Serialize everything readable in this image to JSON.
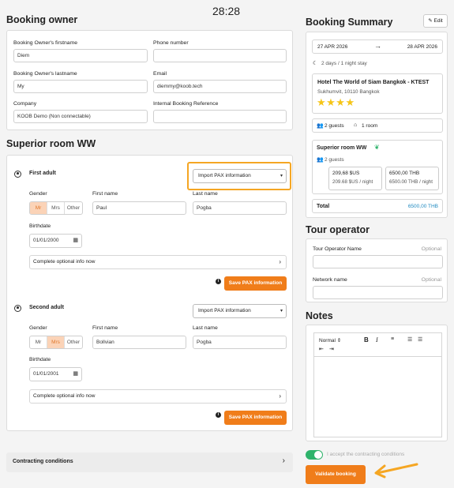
{
  "timer": "28:28",
  "owner": {
    "title": "Booking owner",
    "firstname_label": "Booking Owner's firstname",
    "firstname_value": "Diem",
    "phone_label": "Phone number",
    "phone_value": "",
    "lastname_label": "Booking Owner's lastname",
    "lastname_value": "My",
    "email_label": "Email",
    "email_value": "diemmy@koob.tech",
    "company_label": "Company",
    "company_value": "KOOB Demo (Non connectable)",
    "internal_ref_label": "Internal Booking Reference",
    "internal_ref_value": ""
  },
  "room": {
    "title": "Superior room WW",
    "adults": [
      {
        "title": "First adult",
        "import_label": "Import PAX information",
        "gender_label": "Gender",
        "genders": [
          "Mr",
          "Mrs",
          "Other"
        ],
        "selected_gender": "Mr",
        "firstname_label": "First name",
        "firstname_value": "Paul",
        "lastname_label": "Last name",
        "lastname_value": "Pogba",
        "birthdate_label": "Birthdate",
        "birthdate_value": "01/01/2000",
        "optional_label": "Complete optional info now",
        "save_label": "Save PAX information"
      },
      {
        "title": "Second adult",
        "import_label": "Import PAX information",
        "gender_label": "Gender",
        "genders": [
          "Mr",
          "Mrs",
          "Other"
        ],
        "selected_gender": "Mrs",
        "firstname_label": "First name",
        "firstname_value": "Bollvian",
        "lastname_label": "Last name",
        "lastname_value": "Pogba",
        "birthdate_label": "Birthdate",
        "birthdate_value": "01/01/2001",
        "optional_label": "Complete optional info now",
        "save_label": "Save PAX information"
      }
    ]
  },
  "contracting": {
    "label": "Contracting conditions"
  },
  "summary": {
    "title": "Booking Summary",
    "edit_label": "Edit",
    "date_from": "27 APR 2026",
    "date_to": "28 APR 2026",
    "stay_text": "2 days / 1 night stay",
    "hotel_name": "Hotel The World of Siam Bangkok - KTEST",
    "hotel_address": "Sukhumvit, 10110 Bangkok",
    "stars": 4,
    "guests_text": "2 guests",
    "rooms_text": "1 room",
    "room_name": "Superior room WW",
    "room_guests": "2 guests",
    "price_sus": "209,68 $US",
    "price_sus_night": "209.68 $US / night",
    "price_thb": "6500,00 THB",
    "price_thb_night": "6500.00 THB / night",
    "total_label": "Total",
    "total_value": "6500,00 THB"
  },
  "tour_operator": {
    "title": "Tour operator",
    "name_label": "Tour Operator Name",
    "network_label": "Network name",
    "optional": "Optional"
  },
  "notes": {
    "title": "Notes",
    "format_value": "Normal"
  },
  "accept_label": "I accept the contracting conditions",
  "validate_label": "Validate booking",
  "colors": {
    "accent": "#f07d1a",
    "highlight": "#f5a623",
    "toggle": "#2fb36b",
    "link": "#1f8ac0"
  }
}
